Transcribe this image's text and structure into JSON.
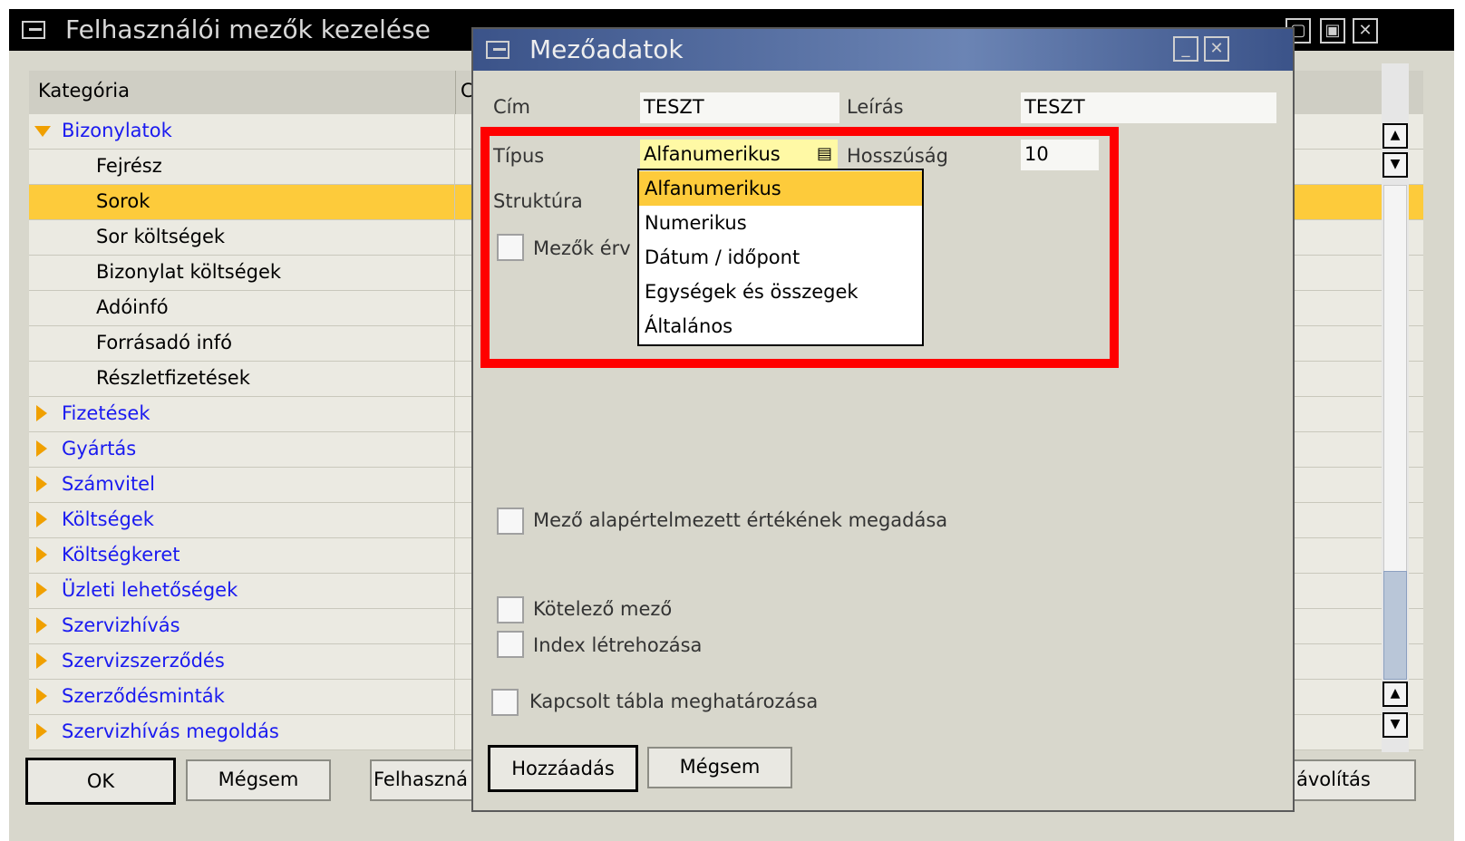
{
  "background_window": {
    "title": "Felhasználói mezők kezelése",
    "columns": [
      "Kategória",
      "Cím"
    ],
    "rows": [
      {
        "label": "Bizonylatok",
        "kind": "group-open"
      },
      {
        "label": "Fejrész",
        "kind": "child"
      },
      {
        "label": "Sorok",
        "kind": "child",
        "selected": true
      },
      {
        "label": "Sor költségek",
        "kind": "child"
      },
      {
        "label": "Bizonylat költségek",
        "kind": "child"
      },
      {
        "label": "Adóinfó",
        "kind": "child"
      },
      {
        "label": "Forrásadó infó",
        "kind": "child"
      },
      {
        "label": "Részletfizetések",
        "kind": "child"
      },
      {
        "label": "Fizetések",
        "kind": "group"
      },
      {
        "label": "Gyártás",
        "kind": "group"
      },
      {
        "label": "Számvitel",
        "kind": "group"
      },
      {
        "label": "Költségek",
        "kind": "group"
      },
      {
        "label": "Költségkeret",
        "kind": "group"
      },
      {
        "label": "Üzleti lehetőségek",
        "kind": "group"
      },
      {
        "label": "Szervizhívás",
        "kind": "group"
      },
      {
        "label": "Szervizszerződés",
        "kind": "group"
      },
      {
        "label": "Szerződésminták",
        "kind": "group"
      },
      {
        "label": "Szervizhívás megoldás",
        "kind": "group"
      }
    ],
    "buttons": {
      "ok": "OK",
      "cancel": "Mégsem",
      "user": "Felhaszná",
      "remove": "ávolítás"
    }
  },
  "dialog": {
    "title": "Mezőadatok",
    "fields": {
      "cim_label": "Cím",
      "cim_value": "TESZT",
      "leiras_label": "Leírás",
      "leiras_value": "TESZT",
      "tipus_label": "Típus",
      "tipus_value": "Alfanumerikus",
      "hossz_label": "Hosszúság",
      "hossz_value": "10",
      "struktura_label": "Struktúra"
    },
    "type_options": [
      "Alfanumerikus",
      "Numerikus",
      "Dátum / időpont",
      "Egységek és összegek",
      "Általános"
    ],
    "selected_option": "Alfanumerikus",
    "checkboxes": {
      "mezok_ervenyes": "Mezők érv",
      "default_value": "Mező alapértelmezett értékének megadása",
      "mandatory": "Kötelező mező",
      "index": "Index létrehozása",
      "linked_table": "Kapcsolt tábla meghatározása"
    },
    "buttons": {
      "add": "Hozzáadás",
      "cancel": "Mégsem"
    }
  },
  "colors": {
    "selection": "#fdcb3b",
    "group_link": "#1a1af0",
    "highlight_border": "#ff0000",
    "dialog_title": "#3b5389"
  }
}
